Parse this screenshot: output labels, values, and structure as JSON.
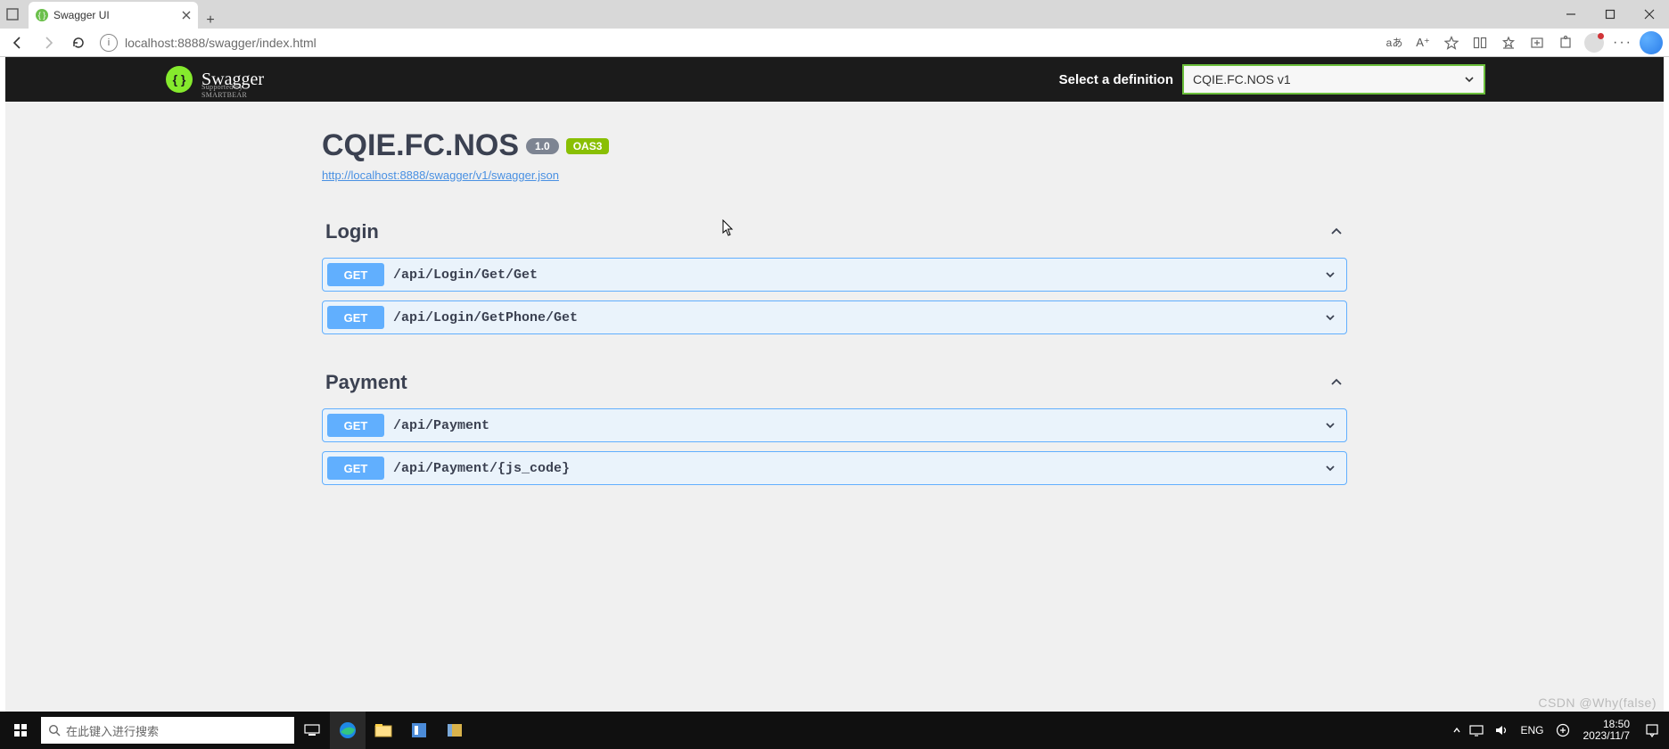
{
  "browser": {
    "tab_title": "Swagger UI",
    "url": "localhost:8888/swagger/index.html"
  },
  "topbar": {
    "select_label": "Select a definition",
    "selected_definition": "CQIE.FC.NOS v1"
  },
  "api": {
    "title": "CQIE.FC.NOS",
    "version_badge": "1.0",
    "oas_badge": "OAS3",
    "spec_url": "http://localhost:8888/swagger/v1/swagger.json"
  },
  "tags": [
    {
      "name": "Login",
      "ops": [
        {
          "method": "GET",
          "path": "/api/Login/Get/Get"
        },
        {
          "method": "GET",
          "path": "/api/Login/GetPhone/Get"
        }
      ]
    },
    {
      "name": "Payment",
      "ops": [
        {
          "method": "GET",
          "path": "/api/Payment"
        },
        {
          "method": "GET",
          "path": "/api/Payment/{js_code}"
        }
      ]
    }
  ],
  "taskbar": {
    "search_placeholder": "在此键入进行搜索",
    "lang": "ENG",
    "time": "18:50",
    "date": "2023/11/7"
  },
  "watermark": "CSDN @Why(false)"
}
